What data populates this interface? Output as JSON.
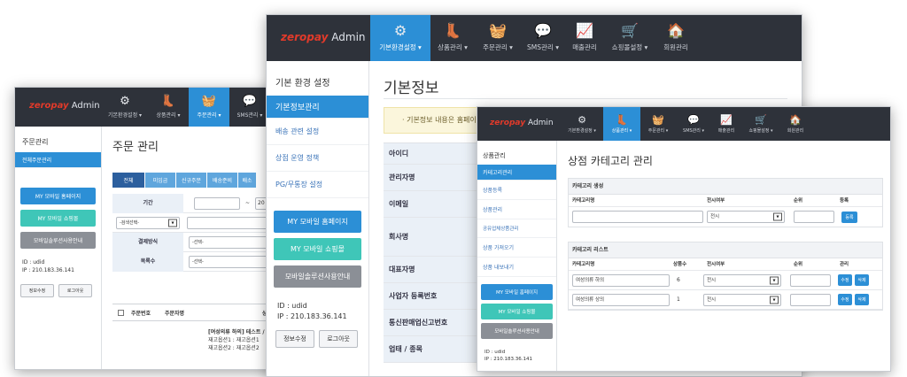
{
  "brand": {
    "zero": "zero",
    "pay": "pay",
    "admin": "Admin"
  },
  "nav": [
    {
      "icon": "gear-icon",
      "glyph": "⚙",
      "label": "기본환경설정 ▾"
    },
    {
      "icon": "boots-icon",
      "glyph": "👢",
      "label": "상품관리 ▾"
    },
    {
      "icon": "basket-icon",
      "glyph": "🧺",
      "label": "주문관리 ▾"
    },
    {
      "icon": "chat-icon",
      "glyph": "💬",
      "label": "SMS관리 ▾"
    },
    {
      "icon": "chart-icon",
      "glyph": "📈",
      "label": "매출관리"
    },
    {
      "icon": "cart-icon",
      "glyph": "🛒",
      "label": "쇼핑몰설정 ▾"
    },
    {
      "icon": "home-icon",
      "glyph": "🏠",
      "label": "회원관리"
    }
  ],
  "side_buttons": {
    "mobile_home": "MY 모바일 홈페이지",
    "mobile_shop": "MY 모바일 쇼핑몰",
    "guide": "모바일솔루션사용안내"
  },
  "user": {
    "id": "ID : udid",
    "ip": "IP : 210.183.36.141",
    "edit": "정보수정",
    "logout": "로그아웃"
  },
  "win_left": {
    "side_title": "주문관리",
    "side_items": [
      "전체주문관리"
    ],
    "title": "주문 관리",
    "tabs": [
      "전체",
      "미입금",
      "신규주문",
      "배송준비",
      "배소"
    ],
    "period_label": "기간",
    "tilde": "~",
    "date_end_partial": "20",
    "search_select": "-검색선택-",
    "pay_label": "결제방식",
    "pay_select": "-선택-",
    "order_label": "목록수",
    "order_select": "-선택-",
    "col_order_no": "주문번호",
    "col_orderer": "주문자명",
    "col_product": "상",
    "product_line1": "[여성의류 하의] 테스트 / 1",
    "product_line2": "재고옵션1 : 재고옵션1",
    "product_line3": "재고옵션2 : 재고옵션2"
  },
  "win_mid": {
    "side_title": "기본 환경 설정",
    "side_items": [
      "기본정보관리",
      "배송 관련 설정",
      "상점 운영 정책",
      "PG/무통장 설정"
    ],
    "title": "기본정보",
    "notice": "·  기본정보 내용은 홈페이",
    "labels": [
      "아이디",
      "관리자명",
      "이메일",
      "회사명",
      "대표자명",
      "사업자 등록번호",
      "통신판매업신고번호",
      "업태 / 종목"
    ]
  },
  "win_right": {
    "side_title": "상품관리",
    "side_items": [
      "카테고리관리",
      "상품등록",
      "상품관리",
      "공유업체상품관리",
      "상품 가져오기",
      "상품 내보내기"
    ],
    "title": "상점 카테고리 관리",
    "create_section": "카테고리 생성",
    "create_cols": [
      "카테고리명",
      "전시여부",
      "순위",
      "등록"
    ],
    "display_option": "전시",
    "register_btn": "등록",
    "list_section": "카테고리 리스트",
    "list_cols": [
      "카테고리명",
      "상품수",
      "전시여부",
      "순위",
      "관리"
    ],
    "rows": [
      {
        "name": "여성의류 하의",
        "count": "6",
        "display": "전시"
      },
      {
        "name": "여성의류 상의",
        "count": "1",
        "display": "전시"
      }
    ],
    "edit_btn": "수정",
    "delete_btn": "삭제"
  }
}
